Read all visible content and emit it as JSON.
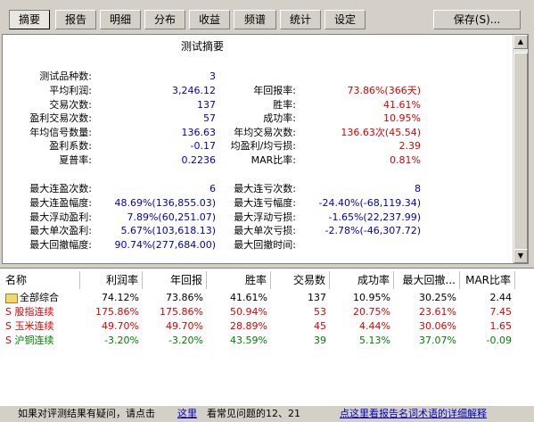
{
  "tabs": [
    "摘要",
    "报告",
    "明细",
    "分布",
    "收益",
    "频谱",
    "统计",
    "设定"
  ],
  "save_label": "保存(S)...",
  "summary": {
    "title": "测试摘要",
    "left": [
      {
        "label": "测试品种数:",
        "value": "3"
      },
      {
        "label": "平均利润:",
        "value": "3,246.12"
      },
      {
        "label": "交易次数:",
        "value": "137"
      },
      {
        "label": "盈利交易次数:",
        "value": "57"
      },
      {
        "label": "年均信号数量:",
        "value": "136.63"
      },
      {
        "label": "盈利系数:",
        "value": "-0.17"
      },
      {
        "label": "夏普率:",
        "value": "0.2236"
      }
    ],
    "right": [
      {
        "label": "年回报率:",
        "value": "73.86%(366天)"
      },
      {
        "label": "胜率:",
        "value": "41.61%"
      },
      {
        "label": "成功率:",
        "value": "10.95%"
      },
      {
        "label": "年均交易次数:",
        "value": "136.63次(45.54)"
      },
      {
        "label": "均盈利/均亏损:",
        "value": "2.39"
      },
      {
        "label": "MAR比率:",
        "value": "0.81%"
      }
    ],
    "left2": [
      {
        "label": "最大连盈次数:",
        "value": "6"
      },
      {
        "label": "最大连盈幅度:",
        "value": "48.69%(136,855.03)"
      },
      {
        "label": "最大浮动盈利:",
        "value": "7.89%(60,251.07)"
      },
      {
        "label": "最大单次盈利:",
        "value": "5.67%(103,618.13)"
      },
      {
        "label": "最大回撤幅度:",
        "value": "90.74%(277,684.00)"
      }
    ],
    "right2": [
      {
        "label": "最大连亏次数:",
        "value": "8"
      },
      {
        "label": "最大连亏幅度:",
        "value": "-24.40%(-68,119.34)"
      },
      {
        "label": "最大浮动亏损:",
        "value": "-1.65%(22,237.99)"
      },
      {
        "label": "最大单次亏损:",
        "value": "-2.78%(-46,307.72)"
      },
      {
        "label": "最大回撤时间:",
        "value": ""
      }
    ]
  },
  "table": {
    "headers": [
      "名称",
      "利润率",
      "年回报",
      "胜率",
      "交易数",
      "成功率",
      "最大回撤...",
      "MAR比率"
    ],
    "rows": [
      {
        "name": "全部综合",
        "cells": [
          "74.12%",
          "73.86%",
          "41.61%",
          "137",
          "10.95%",
          "30.25%",
          "2.44"
        ]
      },
      {
        "name": "股指连续",
        "cells": [
          "175.86%",
          "175.86%",
          "50.94%",
          "53",
          "20.75%",
          "23.61%",
          "7.45"
        ]
      },
      {
        "name": "玉米连续",
        "cells": [
          "49.70%",
          "49.70%",
          "28.89%",
          "45",
          "4.44%",
          "30.06%",
          "1.65"
        ]
      },
      {
        "name": "沪铜连续",
        "cells": [
          "-3.20%",
          "-3.20%",
          "43.59%",
          "39",
          "5.13%",
          "37.07%",
          "-0.09"
        ]
      }
    ]
  },
  "status": {
    "text1": "如果对评测结果有疑问，请点击",
    "link1": "这里",
    "text2": "看常见问题的12、21",
    "link2": "点这里看报告名词术语的详细解释"
  }
}
